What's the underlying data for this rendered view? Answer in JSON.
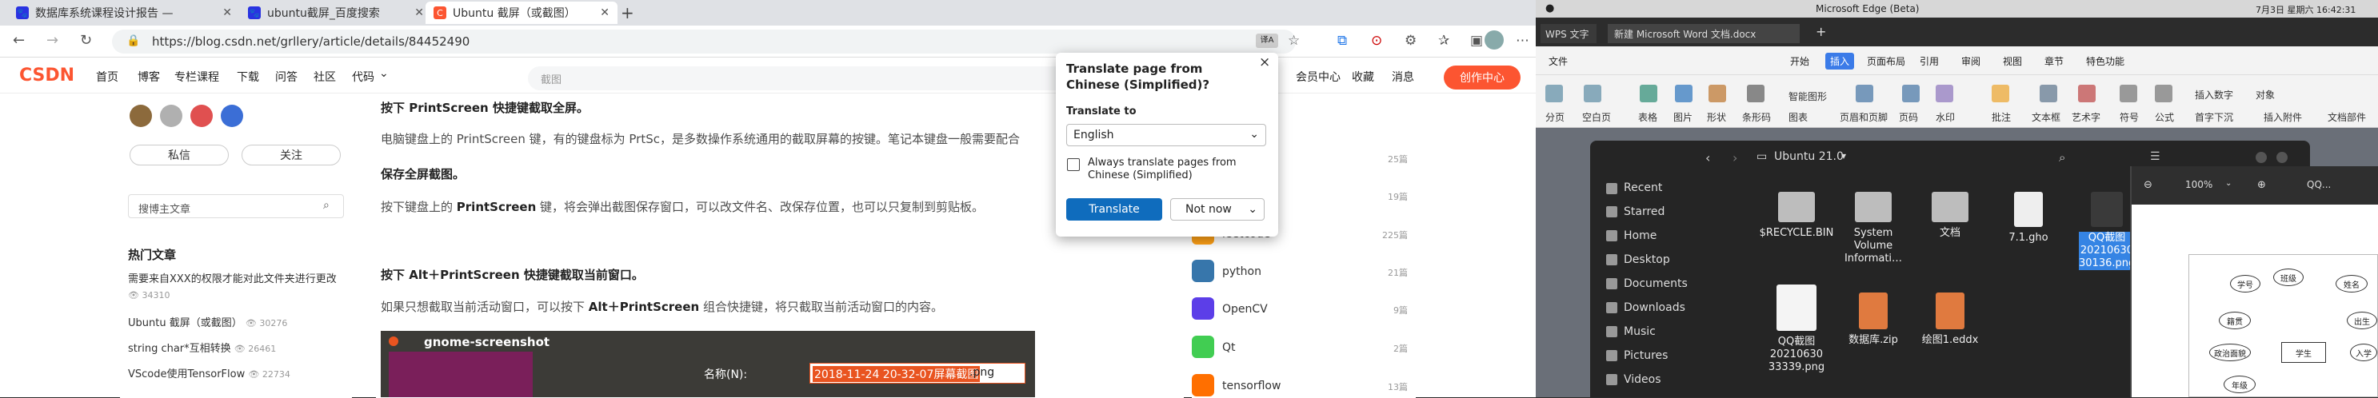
{
  "browser": {
    "tabs": [
      {
        "label": "数据库系统课程设计报告 —",
        "favicon": "paw-icon",
        "color": "#2932e1"
      },
      {
        "label": "ubuntu截屏_百度搜索",
        "favicon": "paw-icon",
        "color": "#2932e1"
      },
      {
        "label": "Ubuntu 截屏（或截图）",
        "favicon": "csdn-icon",
        "color": "#fc5531"
      }
    ],
    "url": "https://blog.csdn.net/grllery/article/details/84452490",
    "new_tab_symbol": "+"
  },
  "csdn": {
    "logo": "CSDN",
    "nav": [
      "首页",
      "博客",
      "专栏课程",
      "下载",
      "问答",
      "社区",
      "代码"
    ],
    "nav_dropdown": "⌄",
    "search_placeholder": "截图",
    "right_nav": [
      "会员中心",
      "收藏",
      "消息"
    ],
    "create_button": "创作中心",
    "left": {
      "private_msg": "私信",
      "follow": "关注",
      "search_placeholder": "搜博主文章",
      "hot_title": "热门文章",
      "hot_items": [
        {
          "title": "需要来自XXX的权限才能对此文件夹进行更改",
          "views": "34310"
        },
        {
          "title": "Ubuntu 截屏（或截图）",
          "views": "30276"
        },
        {
          "title": "string char*互相转换",
          "views": "26461"
        },
        {
          "title": "VScode使用TensorFlow",
          "views": "22734"
        }
      ]
    },
    "article": {
      "h1": "按下 PrintScreen 快捷键截取全屏。",
      "p1": "电脑键盘上的 PrintScreen 键，有的键盘标为 PrtSc，是多数操作系统通用的截取屏幕的按键。笔记本键盘一般需要配合",
      "h2": "保存全屏截图。",
      "p2_pre": "按下键盘上的 ",
      "p2_bold": "PrintScreen",
      "p2_post": " 键，将会弹出截图保存窗口，可以改文件名、改保存位置，也可以只复制到剪贴板。",
      "h3": "按下 Alt＋PrintScreen 快捷键截取当前窗口。",
      "p3_pre": "如果只想截取当前活动窗口，可以按下 ",
      "p3_bold": "Alt＋PrintScreen",
      "p3_post": " 组合快捷键，将只截取当前活动窗口的内容。",
      "screenshot_title": "gnome-screenshot",
      "name_label": "名称(N):",
      "name_value": "2018-11-24 20-32-07屏幕截图",
      "name_ext": ".png"
    },
    "right": {
      "categories": [
        {
          "name": "",
          "count": "25篇"
        },
        {
          "name": "",
          "count": "19篇"
        },
        {
          "name": "leetcode",
          "count": "225篇"
        },
        {
          "name": "python",
          "count": "21篇"
        },
        {
          "name": "OpenCV",
          "count": "9篇"
        },
        {
          "name": "Qt",
          "count": "2篇"
        },
        {
          "name": "tensorflow",
          "count": "13篇"
        }
      ]
    }
  },
  "translate_popup": {
    "title": "Translate page from Chinese (Simplified)?",
    "label": "Translate to",
    "selected": "English",
    "checkbox": "Always translate pages from Chinese (Simplified)",
    "translate_btn": "Translate",
    "not_now_btn": "Not now",
    "close": "×"
  },
  "desktop": {
    "app_title": "Microsoft Edge (Beta)",
    "datetime": "7月3日 星期六 16:42:31",
    "wps_tabs": [
      "WPS 文字",
      "新建 Microsoft Word 文档.docx"
    ],
    "wps_menu": [
      "文件",
      "开始",
      "插入",
      "页面布局",
      "引用",
      "审阅",
      "视图",
      "章节",
      "特色功能"
    ],
    "wps_active_menu": "插入",
    "ribbon": [
      "分页",
      "空白页",
      "表格",
      "图片",
      "形状",
      "条形码",
      "图表",
      "智能图形",
      "页眉和页脚",
      "页码",
      "水印",
      "批注",
      "文本框",
      "艺术字",
      "符号",
      "公式",
      "插入数字",
      "对象",
      "首字下沉",
      "插入附件",
      "文档部件"
    ],
    "fm_path": "Ubuntu 21.0",
    "sidebar": [
      "Recent",
      "Starred",
      "Home",
      "Desktop",
      "Documents",
      "Downloads",
      "Music",
      "Pictures",
      "Videos"
    ],
    "files": [
      {
        "name": "$RECYCLE.BIN",
        "type": "folder"
      },
      {
        "name": "System Volume Informati…",
        "type": "folder"
      },
      {
        "name": "文档",
        "type": "folder"
      },
      {
        "name": "7.1.gho",
        "type": "doc"
      },
      {
        "name": "QQ截图20210630 30136.png",
        "type": "image",
        "selected": true
      },
      {
        "name": "QQ截图20210630 33339.png",
        "type": "image"
      },
      {
        "name": "数据库.zip",
        "type": "zip"
      },
      {
        "name": "绘图1.eddx",
        "type": "zip"
      }
    ],
    "viewer_zoom": "100%",
    "viewer_title": "QQ...",
    "diagram_nodes": [
      "学号",
      "班级",
      "姓名",
      "籍贯",
      "学生",
      "出生",
      "政治面貌",
      "入学",
      "年级"
    ]
  },
  "colors": {
    "csdn": "#fc5531",
    "edge_blue": "#0f6cbd",
    "fm_select": "#3584e4"
  }
}
